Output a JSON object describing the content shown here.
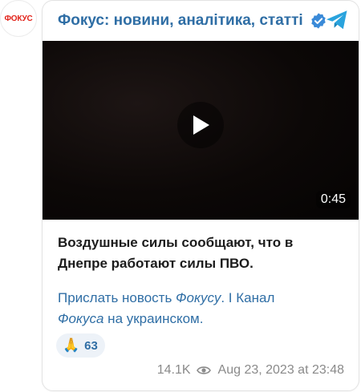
{
  "channel": {
    "avatar_text": "ФОКУС",
    "title": "Фокус: новини, аналітика, статті"
  },
  "video": {
    "duration": "0:45"
  },
  "message": {
    "line1": "Воздушные силы сообщают, что в",
    "line2": "Днепре работают силы ПВО."
  },
  "links": {
    "part1": "Прислать новость ",
    "part2": "Фокусу",
    "part3": ". I ",
    "part4": "Канал",
    "part5": "Фокуса",
    "part6": " на украинском."
  },
  "reaction": {
    "emoji": "🙏",
    "count": "63"
  },
  "footer": {
    "views": "14.1K",
    "date": "Aug 23, 2023 at 23:48"
  },
  "colors": {
    "accent": "#2f6ea5",
    "brand_red": "#e2231a",
    "verified": "#3a8ad8",
    "telegram": "#2aa3dd"
  }
}
